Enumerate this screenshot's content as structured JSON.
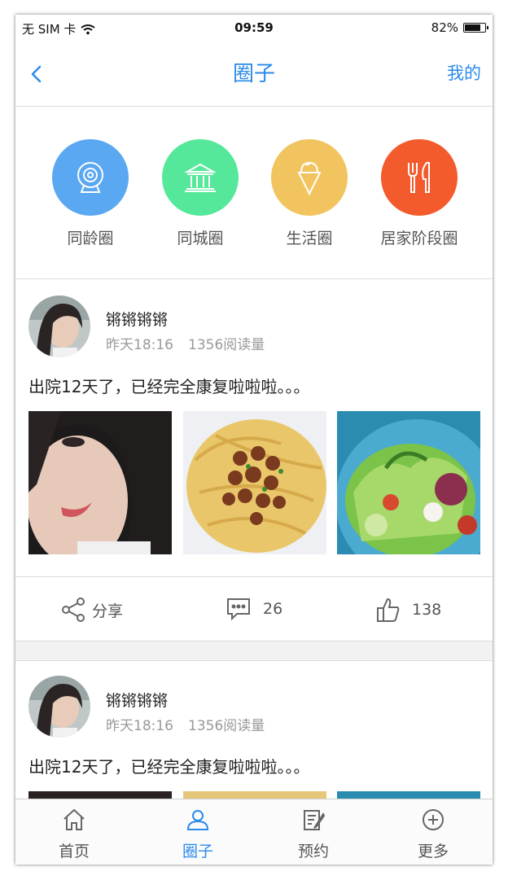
{
  "status_bar": {
    "carrier": "无 SIM 卡",
    "time": "09:59",
    "battery": "82%",
    "battery_level": 0.82
  },
  "nav": {
    "title": "圈子",
    "right_label": "我的"
  },
  "categories": [
    {
      "label": "同龄圈",
      "color": "#5aa7f2",
      "icon": "camera-icon"
    },
    {
      "label": "同城圈",
      "color": "#56e89a",
      "icon": "building-icon"
    },
    {
      "label": "生活圈",
      "color": "#f2c45f",
      "icon": "ice-cream-icon"
    },
    {
      "label": "居家阶段圈",
      "color": "#f45b2c",
      "icon": "fork-knife-icon"
    }
  ],
  "posts": [
    {
      "username": "锵锵锵锵",
      "time": "昨天18:16",
      "views": "1356阅读量",
      "text": "出院12天了，已经完全康复啦啦啦。。。",
      "share_label": "分享",
      "comments": "26",
      "likes": "138"
    },
    {
      "username": "锵锵锵锵",
      "time": "昨天18:16",
      "views": "1356阅读量",
      "text": "出院12天了，已经完全康复啦啦啦。。。"
    }
  ],
  "tabs": [
    {
      "label": "首页",
      "icon": "home-icon"
    },
    {
      "label": "圈子",
      "icon": "people-icon",
      "active": true
    },
    {
      "label": "预约",
      "icon": "appointment-icon"
    },
    {
      "label": "更多",
      "icon": "plus-circle-icon"
    }
  ],
  "colors": {
    "accent": "#2a8bea",
    "divider": "#dcdcdc",
    "section_gap": "#f2f2f2"
  }
}
